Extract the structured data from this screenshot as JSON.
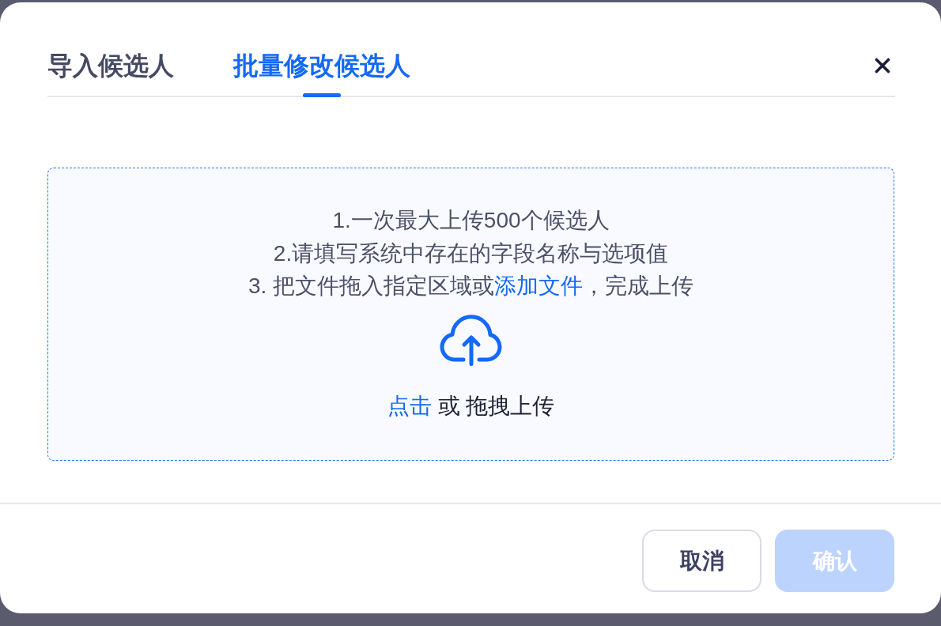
{
  "tabs": [
    {
      "label": "导入候选人",
      "selected": false
    },
    {
      "label": "批量修改候选人",
      "selected": true
    }
  ],
  "upload_area": {
    "instructions": [
      {
        "text": "1.一次最大上传500个候选人"
      },
      {
        "text": "2.请填写系统中存在的字段名称与选项值"
      },
      {
        "text": "3. 把文件拖入指定区域或",
        "link": "添加文件",
        "after": "，完成上传"
      }
    ],
    "prompt": {
      "link": "点击",
      "text": "或 拖拽上传"
    }
  },
  "buttons": [
    {
      "label": "取消",
      "kind": "secondary",
      "disabled": false
    },
    {
      "label": "确认",
      "kind": "primary",
      "disabled": true
    }
  ]
}
